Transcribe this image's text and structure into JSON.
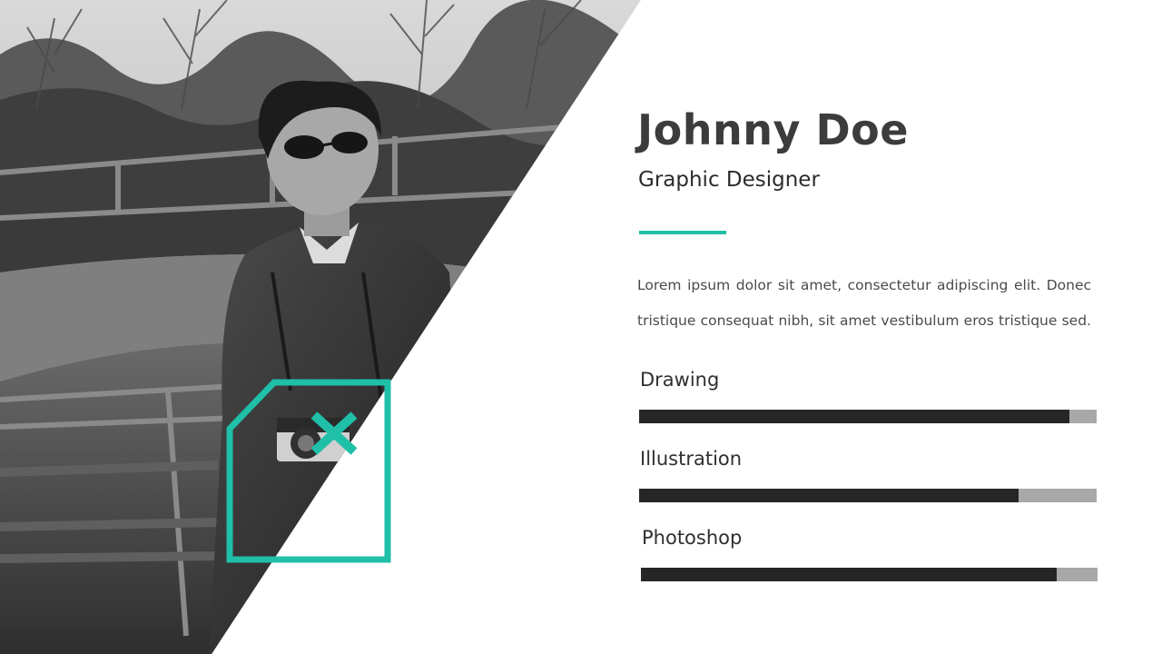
{
  "profile": {
    "name": "Johnny Doe",
    "role": "Graphic Designer",
    "description_line1": "Lorem ipsum dolor sit amet, consectetur adipiscing elit. Donec",
    "description_line2": "tristique consequat nibh, sit amet vestibulum eros tristique sed."
  },
  "skills": [
    {
      "label": "Drawing",
      "level": 0.94
    },
    {
      "label": "Illustration",
      "level": 0.83
    },
    {
      "label": "Photoshop",
      "level": 0.91
    }
  ],
  "colors": {
    "accent": "#1fbfa8",
    "bar_fill": "#262626",
    "bar_track": "#a8a8a8",
    "title": "#3c3c3c"
  },
  "icons": {
    "accent_mark": "close-x-icon"
  }
}
